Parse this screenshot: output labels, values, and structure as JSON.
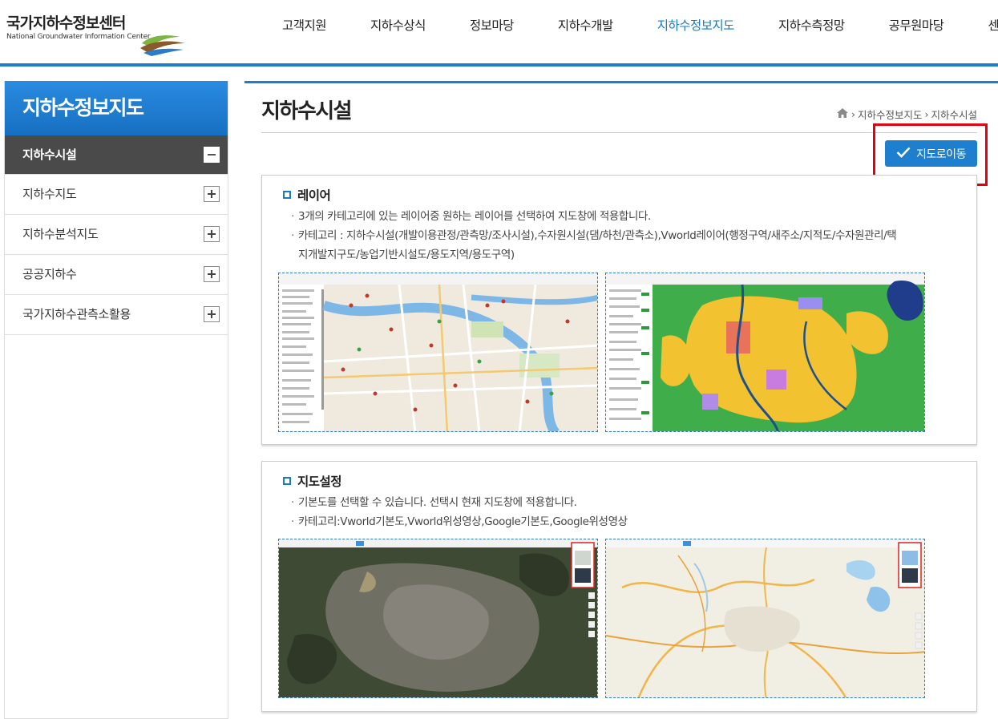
{
  "header": {
    "logo_title": "국가지하수정보센터",
    "logo_sub": "National Groundwater Information Center",
    "nav": [
      {
        "label": "고객지원",
        "active": false
      },
      {
        "label": "지하수상식",
        "active": false
      },
      {
        "label": "정보마당",
        "active": false
      },
      {
        "label": "지하수개발",
        "active": false
      },
      {
        "label": "지하수정보지도",
        "active": true
      },
      {
        "label": "지하수측정망",
        "active": false
      },
      {
        "label": "공무원마당",
        "active": false
      },
      {
        "label": "센터소개",
        "active": false
      }
    ]
  },
  "sidebar": {
    "title": "지하수정보지도",
    "items": [
      {
        "label": "지하수시설",
        "active": true
      },
      {
        "label": "지하수지도",
        "active": false
      },
      {
        "label": "지하수분석지도",
        "active": false
      },
      {
        "label": "공공지하수",
        "active": false
      },
      {
        "label": "국가지하수관측소활용",
        "active": false
      }
    ]
  },
  "content": {
    "page_title": "지하수시설",
    "breadcrumb": [
      "지하수정보지도",
      "지하수시설"
    ],
    "map_button_label": "지도로이동",
    "panel_layer": {
      "title": "레이어",
      "line1": "3개의 카테고리에 있는 레이어중 원하는 레이어를 선택하여 지도창에 적용합니다.",
      "line2a": "카테고리 : 지하수시설(개발이용관정/관측망/조사시설),수자원시설(댐/하천/관측소),Vworld레이어(행정구역/새주소/지적도/수자원관리/택",
      "line2b": "지개발지구도/농업기반시설도/용도지역/용도구역)"
    },
    "panel_mapset": {
      "title": "지도설정",
      "line1": "기본도를 선택할 수 있습니다. 선택시 현재 지도창에 적용합니다.",
      "line2": "카테고리:Vworld기본도,Vworld위성영상,Google기본도,Google위성영상"
    }
  },
  "colors": {
    "accent": "#1e7ec8",
    "highlight": "#e3000f",
    "sidebar_active": "#4a4a4a"
  },
  "icons": [
    "home-icon",
    "check-icon",
    "plus-icon",
    "minus-icon",
    "square-bullet-icon"
  ]
}
